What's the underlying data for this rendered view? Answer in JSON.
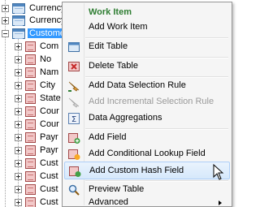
{
  "tree": {
    "items": [
      {
        "label": "Currency"
      },
      {
        "label": "Currency"
      },
      {
        "label": "Custome"
      },
      {
        "label": "Com"
      },
      {
        "label": "No"
      },
      {
        "label": "Nam"
      },
      {
        "label": "City"
      },
      {
        "label": "State"
      },
      {
        "label": "Cour"
      },
      {
        "label": "Cour"
      },
      {
        "label": "Payr"
      },
      {
        "label": "Payr"
      },
      {
        "label": "Cust"
      },
      {
        "label": "Cust"
      },
      {
        "label": "Cust"
      },
      {
        "label": "Cust"
      }
    ]
  },
  "context_menu": {
    "items": [
      {
        "label": "Work Item"
      },
      {
        "label": "Add Work Item"
      },
      {
        "label": "Edit Table"
      },
      {
        "label": "Delete Table"
      },
      {
        "label": "Add Data Selection Rule"
      },
      {
        "label": "Add Incremental Selection Rule"
      },
      {
        "label": "Data Aggregations"
      },
      {
        "label": "Add Field"
      },
      {
        "label": "Add Conditional Lookup Field"
      },
      {
        "label": "Add Custom Hash Field"
      },
      {
        "label": "Preview Table"
      },
      {
        "label": "Advanced"
      }
    ]
  },
  "colors": {
    "selection": "#3399ff",
    "menu_header": "#2e7d32",
    "menu_hover_border": "#aecff7",
    "disabled_text": "#9a9a9a"
  }
}
